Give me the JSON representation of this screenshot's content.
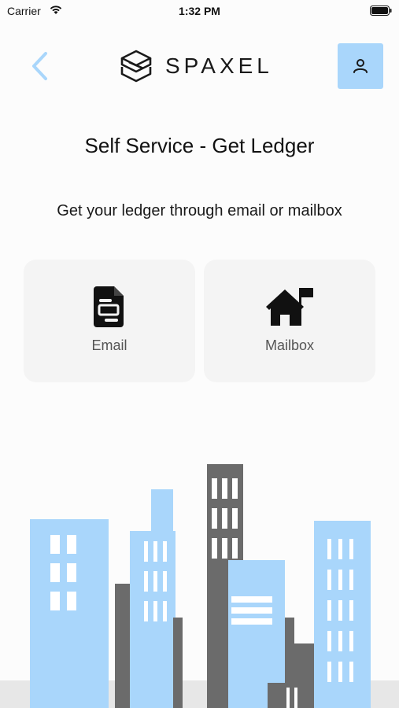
{
  "status_bar": {
    "carrier": "Carrier",
    "time": "1:32 PM"
  },
  "header": {
    "brand": "SPAXEL"
  },
  "page": {
    "title": "Self Service - Get Ledger",
    "subtitle": "Get your ledger through email or mailbox"
  },
  "options": [
    {
      "label": "Email",
      "icon": "document-icon"
    },
    {
      "label": "Mailbox",
      "icon": "house-flag-icon"
    }
  ],
  "colors": {
    "accent": "#a9d6fb",
    "building_dark": "#6b6b6b",
    "card": "#f4f4f4"
  }
}
